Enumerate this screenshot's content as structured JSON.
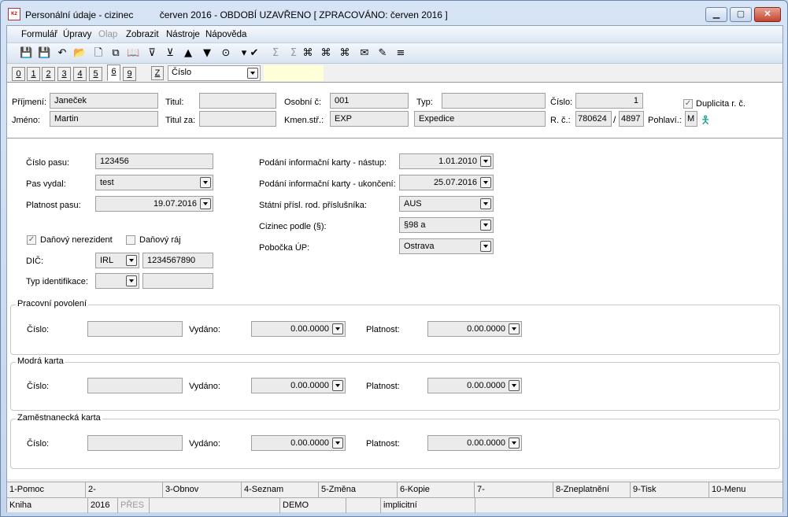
{
  "window": {
    "title": "Personální údaje - cizinec          červen 2016 - OBDOBÍ UZAVŘENO [ ZPRACOVÁNO: červen 2016 ]",
    "icon_text": "K2",
    "minimize": "▁",
    "maximize": "▢",
    "close": "✕"
  },
  "menu": [
    {
      "label": "Formulář",
      "enabled": true
    },
    {
      "label": "Úpravy",
      "enabled": true
    },
    {
      "label": "Olap",
      "enabled": false
    },
    {
      "label": "Zobrazit",
      "enabled": true
    },
    {
      "label": "Nástroje",
      "enabled": true
    },
    {
      "label": "Nápověda",
      "enabled": true
    }
  ],
  "toolbar": {
    "icons": [
      "save-icon",
      "save-all-icon",
      "undo-icon",
      "open-folder-icon",
      "new-document-icon",
      "copy-document-icon",
      "book-icon",
      "filter-icon",
      "clear-filter-icon",
      "arrow-up-icon",
      "arrow-down-icon",
      "camera-icon",
      "dropdown-arrow-icon",
      "check-green-icon",
      "sum-icon",
      "sum-filter-icon",
      "binoculars-icon",
      "find-next-icon",
      "find-prev-icon",
      "mail-icon",
      "notes-icon",
      "menu-lines-icon"
    ],
    "glyphs": [
      "💾",
      "💾",
      "↶",
      "📂",
      "🗋",
      "⧉",
      "📖",
      "⊽",
      "⊻",
      "▲",
      "▼",
      "⊙",
      "▾",
      "✔",
      "Σ",
      "Σ",
      "⌘",
      "⌘",
      "⌘",
      "✉",
      "✎",
      "≡"
    ]
  },
  "tabs": [
    "0",
    "1",
    "2",
    "3",
    "4",
    "5",
    "6",
    "9"
  ],
  "active_tab": "6",
  "sort_key": {
    "button": "Z",
    "value": "Číslo"
  },
  "header": {
    "prijmeni_label": "Příjmení:",
    "prijmeni": "Janeček",
    "jmeno_label": "Jméno:",
    "jmeno": "Martin",
    "titul_label": "Titul:",
    "titul": "",
    "titul_za_label": "Titul za:",
    "titul_za": "",
    "osobni_label": "Osobní č:",
    "osobni": "001",
    "kmen_label": "Kmen.stř.:",
    "kmen_code": "EXP",
    "kmen_name": "Expedice",
    "typ_label": "Typ:",
    "typ": "",
    "cislo_label": "Číslo:",
    "cislo": "1",
    "rc_label": "R. č.:",
    "rc1": "780624",
    "rc_sep": "/",
    "rc2": "4897",
    "duplicita_label": "Duplicita r. č.",
    "pohlavi_label": "Pohlaví.:",
    "pohlavi": "M"
  },
  "left": {
    "cislo_pasu_label": "Číslo pasu:",
    "cislo_pasu": "123456",
    "pas_vydal_label": "Pas vydal:",
    "pas_vydal": "test",
    "platnost_pasu_label": "Platnost pasu:",
    "platnost_pasu": "19.07.2016",
    "danovy_nerezident_label": "Daňový nerezident",
    "danovy_nerezident": true,
    "danovy_raj_label": "Daňový ráj",
    "danovy_raj": false,
    "dic_label": "DIČ:",
    "dic_country": "IRL",
    "dic": "1234567890",
    "typ_identifikace_label": "Typ identifikace:",
    "typ_identifikace": "",
    "typ_identifikace_value": ""
  },
  "right": {
    "nastup_label": "Podání informační karty - nástup:",
    "nastup": "1.01.2010",
    "ukonceni_label": "Podání informační karty - ukončení:",
    "ukonceni": "25.07.2016",
    "statni_label": "Státní přísl. rod. příslušníka:",
    "statni": "AUS",
    "cizinec_label": "Cizinec podle (§):",
    "cizinec": "§98 a",
    "pobocka_label": "Pobočka ÚP:",
    "pobocka": "Ostrava"
  },
  "groups": [
    {
      "title": "Pracovní povolení",
      "cislo_label": "Číslo:",
      "cislo": "",
      "vydano_label": "Vydáno:",
      "vydano": "0.00.0000",
      "platnost_label": "Platnost:",
      "platnost": "0.00.0000"
    },
    {
      "title": "Modrá karta",
      "cislo_label": "Číslo:",
      "cislo": "",
      "vydano_label": "Vydáno:",
      "vydano": "0.00.0000",
      "platnost_label": "Platnost:",
      "platnost": "0.00.0000"
    },
    {
      "title": "Zaměstnanecká karta",
      "cislo_label": "Číslo:",
      "cislo": "",
      "vydano_label": "Vydáno:",
      "vydano": "0.00.0000",
      "platnost_label": "Platnost:",
      "platnost": "0.00.0000"
    }
  ],
  "fkeys": [
    "1-Pomoc",
    "2-",
    "3-Obnov",
    "4-Seznam",
    "5-Změna",
    "6-Kopie",
    "7-",
    "8-Zneplatnění",
    "9-Tisk",
    "10-Menu"
  ],
  "status": [
    "Kniha",
    "2016",
    "PŘES",
    "",
    "DEMO",
    "",
    "implicitní",
    ""
  ]
}
